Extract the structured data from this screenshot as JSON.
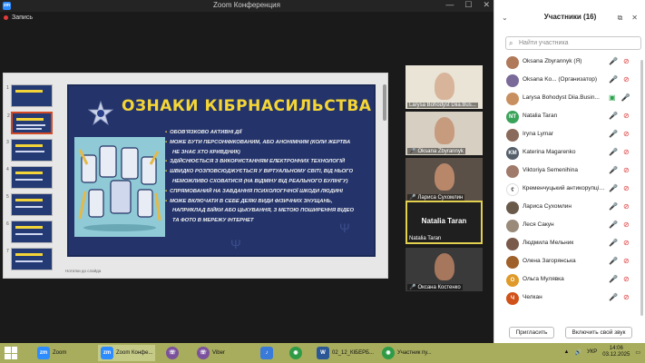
{
  "window": {
    "title": "Zoom Конференция",
    "app_icon": "zm",
    "controls": [
      "—",
      "☐",
      "✕"
    ]
  },
  "recording": {
    "label": "Запись"
  },
  "slide": {
    "title": "ОЗНАКИ КІБРНАСИЛЬСТВА",
    "bullets": [
      {
        "text": "ОБОВ'ЯЗКОВО АКТИВНІ ДІЇ",
        "cont": ""
      },
      {
        "text": "МОЖЕ БУТИ ПЕРСОНІФІКОВАНИМ, АБО АНОНІМНИМ (КОЛИ ЖЕРТВА",
        "cont": "НЕ ЗНАЄ ХТО КРИВДНИК)"
      },
      {
        "text": "ЗДІЙСНЮЄТЬСЯ З ВИКОРИСТАННЯМ ЕЛЕКТРОННИХ ТЕХНОЛОГІЙ",
        "cont": ""
      },
      {
        "text": "ШВИДКО РОЗПОВСЮДЖУЄТЬСЯ У ВІРТУАЛЬНОМУ СВІТІ, ВІД НЬОГО",
        "cont": "НЕМОЖЛИВО СХОВАТИСЯ (НА ВІДМІНУ ВІД РЕАЛЬНОГО БУЛІНГУ)"
      },
      {
        "text": "СПРЯМОВАНИЙ НА ЗАВДАННЯ ПСИХОЛОГІЧНОЇ ШКОДИ ЛЮДИНІ",
        "cont": ""
      },
      {
        "text": "МОЖЕ ВКЛЮЧАТИ В СЕБЕ ДЕЯКІ ВИДИ ФІЗИЧНИХ ЗНУЩАНЬ,",
        "cont": "НАПРИКЛАД БІЙКИ АБО ЦЬКУВАННЯ, З МЕТОЮ ПОШИРЕННЯ ВІДЕО"
      },
      {
        "text": "",
        "cont": "ТА ФОТО В МЕРЕЖУ ІНТЕРНЕТ"
      }
    ],
    "notes": "Нотатки до слайда"
  },
  "video_tiles": [
    {
      "name": "Larysa Bohodyst Diia.Bus...",
      "muted": false
    },
    {
      "name": "Oksana Zbyrannyk",
      "muted": true
    },
    {
      "name": "Лариса Сухомлин",
      "muted": true
    },
    {
      "name": "Natalia Taran",
      "muted": false,
      "active": true,
      "center_name": "Natalia Taran"
    },
    {
      "name": "Оксана Костенко",
      "muted": true
    }
  ],
  "panel": {
    "title": "Участники (16)",
    "search_placeholder": "Найти участника",
    "participants": [
      {
        "name": "Oksana Zbyrannyk (Я)",
        "avatar_color": "#b07a5a",
        "initials": ""
      },
      {
        "name": "Oksana Ko... (Организатор)",
        "avatar_color": "#7a6a9a",
        "initials": ""
      },
      {
        "name": "Larysa Bohodyst Diia.Busin...",
        "avatar_color": "#c89060",
        "initials": ""
      },
      {
        "name": "Natalia Taran",
        "avatar_color": "#3aa35a",
        "initials": "NT"
      },
      {
        "name": "Iryna Lymar",
        "avatar_color": "#8a6a5a",
        "initials": ""
      },
      {
        "name": "Katerina Magarenko",
        "avatar_color": "#555f6a",
        "initials": "KM"
      },
      {
        "name": "Viktoriya Semenihina",
        "avatar_color": "#a07a6a",
        "initials": ""
      },
      {
        "name": "Кременчуцький антикорупційн...",
        "avatar_color": "#ffffff",
        "initials": ""
      },
      {
        "name": "Лариса Сухомлин",
        "avatar_color": "#6a5a4a",
        "initials": ""
      },
      {
        "name": "Леся Сакун",
        "avatar_color": "#9a8a7a",
        "initials": ""
      },
      {
        "name": "Людмила Мельник",
        "avatar_color": "#7a5a4a",
        "initials": ""
      },
      {
        "name": "Олена Загорянська",
        "avatar_color": "#a0602a",
        "initials": ""
      },
      {
        "name": "Ольга Мулявка",
        "avatar_color": "#e09a2a",
        "initials": "О"
      },
      {
        "name": "Челкан",
        "avatar_color": "#d0521a",
        "initials": "Ч"
      }
    ],
    "invite_label": "Пригласить",
    "unmute_label": "Включить свой звук"
  },
  "taskbar": {
    "items": [
      {
        "label": "Zoom",
        "icon": "zm",
        "color": "#2d8cff"
      },
      {
        "label": "Zoom Конфе...",
        "icon": "zm",
        "color": "#2d8cff",
        "active": true
      },
      {
        "label": "",
        "icon": "viber",
        "color": "#7b519d"
      },
      {
        "label": "Viber",
        "icon": "viber",
        "color": "#7b519d"
      },
      {
        "label": "",
        "icon": "audio",
        "color": "#3a7ad8"
      },
      {
        "label": "",
        "icon": "chrome",
        "color": "#2f9b46"
      },
      {
        "label": "02_12_КІБЕРБ...",
        "icon": "word",
        "color": "#2b5797"
      },
      {
        "label": "Участник пу...",
        "icon": "chrome",
        "color": "#2f9b46"
      }
    ],
    "lang": "УКР",
    "time": "14:06",
    "date": "03.12.2025"
  }
}
